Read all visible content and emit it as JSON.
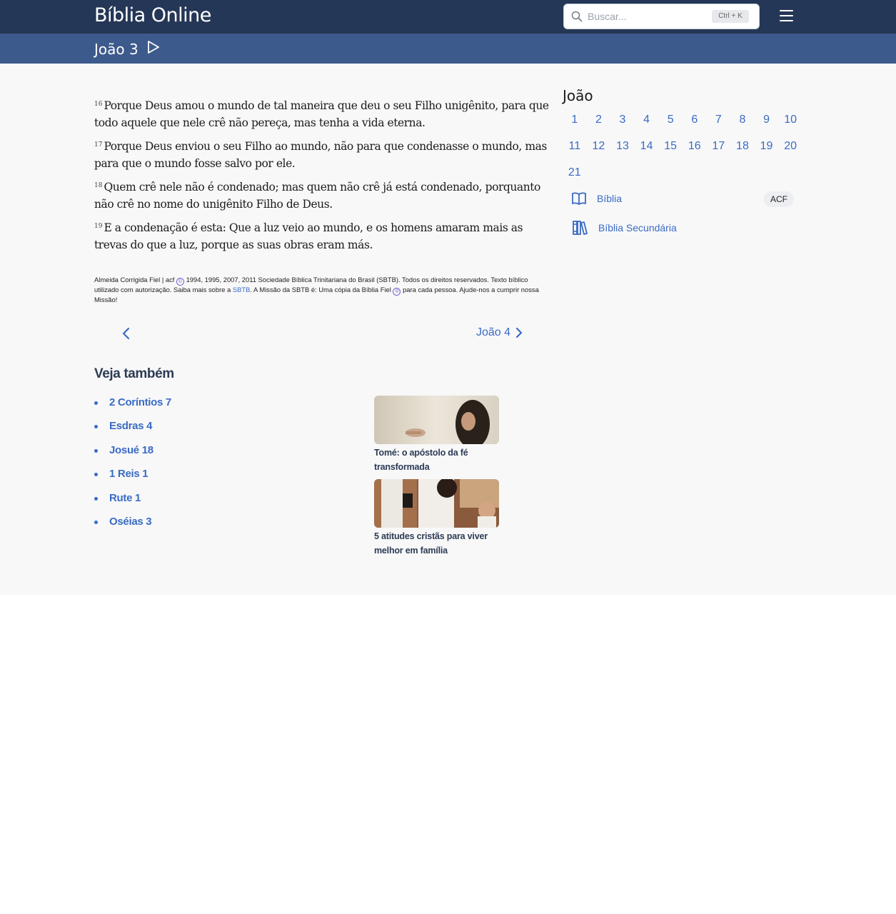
{
  "header": {
    "site_title": "Bíblia Online",
    "search_placeholder": "Buscar...",
    "search_shortcut": "Ctrl + K",
    "menu_icon": "hamburger-menu-icon"
  },
  "subheader": {
    "chapter_title": "João 3",
    "play_icon": "play-icon"
  },
  "verses": [
    {
      "number": "16",
      "text": "Porque Deus amou o mundo de tal maneira que deu o seu Filho unigênito, para que todo aquele que nele crê não pereça, mas tenha a vida eterna."
    },
    {
      "number": "17",
      "text": "Porque Deus enviou o seu Filho ao mundo, não para que condenasse o mundo, mas para que o mundo fosse salvo por ele."
    },
    {
      "number": "18",
      "text": "Quem crê nele não é condenado; mas quem não crê já está condenado, porquanto não crê no nome do unigênito Filho de Deus."
    },
    {
      "number": "19",
      "text": "E a condenação é esta: Que a luz veio ao mundo, e os homens amaram mais as trevas do que a luz, porque as suas obras eram más."
    }
  ],
  "copyright": {
    "part1": "Almeida Corrigida Fiel | acf",
    "symbol_c": "©",
    "part2": "1994, 1995, 2007, 2011 Sociedade Bíblica Trinitariana do Brasil (SBTB). Todos os direitos reservados. Texto bíblico utilizado com autorização. Saiba mais sobre a",
    "sbtb_link": "SBTB",
    "part3": ". A Missão da SBTB é: Uma cópia da Bíblia Fiel",
    "symbol_r": "®",
    "part4": "para cada pessoa. Ajude-nos a cumprir nossa Missão!"
  },
  "pagination": {
    "prev_icon": "chevron-left-icon",
    "next_label": "João 4",
    "next_icon": "chevron-right-icon"
  },
  "see_also": {
    "title": "Veja também",
    "links": [
      "2 Coríntios 7",
      "Esdras 4",
      "Josué 18",
      "1 Reis 1",
      "Rute 1",
      "Oséias 3"
    ],
    "articles": [
      {
        "title": "Tomé: o apóstolo da fé transformada"
      },
      {
        "title": "5 atitudes cristãs para viver melhor em família"
      }
    ]
  },
  "sidebar": {
    "book_title": "João",
    "chapters": [
      "1",
      "2",
      "3",
      "4",
      "5",
      "6",
      "7",
      "8",
      "9",
      "10",
      "11",
      "12",
      "13",
      "14",
      "15",
      "16",
      "17",
      "18",
      "19",
      "20",
      "21"
    ],
    "bible_link": "Bíblia",
    "version_badge": "ACF",
    "secondary_link": "Bíblia Secundária"
  },
  "colors": {
    "topbar": "#253756",
    "subbar": "#3d5a8c",
    "link": "#3a6bc4",
    "background": "#f8f8f9"
  }
}
